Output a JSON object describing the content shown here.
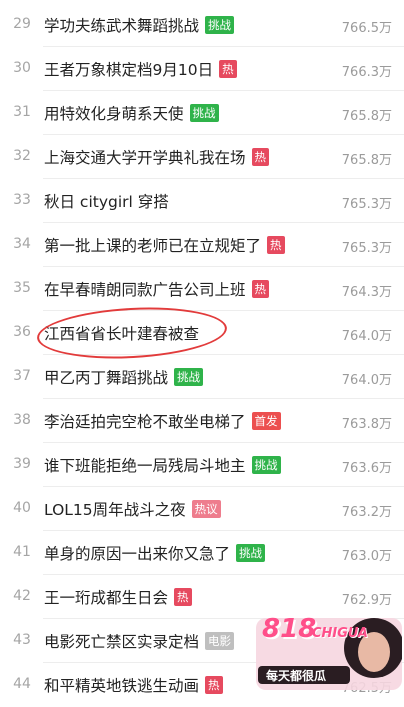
{
  "items": [
    {
      "rank": "29",
      "title": "学功夫练武术舞蹈挑战",
      "badge": "挑战",
      "badge_type": "challenge",
      "count": "766.5万"
    },
    {
      "rank": "30",
      "title": "王者万象棋定档9月10日",
      "badge": "热",
      "badge_type": "hot",
      "count": "766.3万"
    },
    {
      "rank": "31",
      "title": "用特效化身萌系天使",
      "badge": "挑战",
      "badge_type": "challenge",
      "count": "765.8万"
    },
    {
      "rank": "32",
      "title": "上海交通大学开学典礼我在场",
      "badge": "热",
      "badge_type": "hot",
      "count": "765.8万"
    },
    {
      "rank": "33",
      "title": "秋日 citygirl 穿搭",
      "badge": "",
      "badge_type": "",
      "count": "765.3万"
    },
    {
      "rank": "34",
      "title": "第一批上课的老师已在立规矩了",
      "badge": "热",
      "badge_type": "hot",
      "count": "765.3万"
    },
    {
      "rank": "35",
      "title": "在早春晴朗同款广告公司上班",
      "badge": "热",
      "badge_type": "hot",
      "count": "764.3万"
    },
    {
      "rank": "36",
      "title": "江西省省长叶建春被查",
      "badge": "",
      "badge_type": "",
      "count": "764.0万"
    },
    {
      "rank": "37",
      "title": "甲乙丙丁舞蹈挑战",
      "badge": "挑战",
      "badge_type": "challenge",
      "count": "764.0万"
    },
    {
      "rank": "38",
      "title": "李治廷拍完空枪不敢坐电梯了",
      "badge": "首发",
      "badge_type": "first",
      "count": "763.8万"
    },
    {
      "rank": "39",
      "title": "谁下班能拒绝一局残局斗地主",
      "badge": "挑战",
      "badge_type": "challenge",
      "count": "763.6万"
    },
    {
      "rank": "40",
      "title": "LOL15周年战斗之夜",
      "badge": "热议",
      "badge_type": "disc",
      "count": "763.2万"
    },
    {
      "rank": "41",
      "title": "单身的原因一出来你又急了",
      "badge": "挑战",
      "badge_type": "challenge",
      "count": "763.0万"
    },
    {
      "rank": "42",
      "title": "王一珩成都生日会",
      "badge": "热",
      "badge_type": "hot",
      "count": "762.9万"
    },
    {
      "rank": "43",
      "title": "电影死亡禁区实录定档",
      "badge": "电影",
      "badge_type": "movie",
      "count": ""
    },
    {
      "rank": "44",
      "title": "和平精英地铁逃生动画",
      "badge": "热",
      "badge_type": "hot",
      "count": "762.5万"
    }
  ],
  "watermark": {
    "logo_text": "818",
    "sub_text": "CHIGUA",
    "slogan": "每天都很瓜"
  },
  "colors": {
    "challenge": "#2fb34a",
    "hot": "#e64a5f",
    "first": "#ec4f4f",
    "disc": "#ee7d8d",
    "movie": "#bfbfbf",
    "highlight_circle": "#e23b3b"
  }
}
